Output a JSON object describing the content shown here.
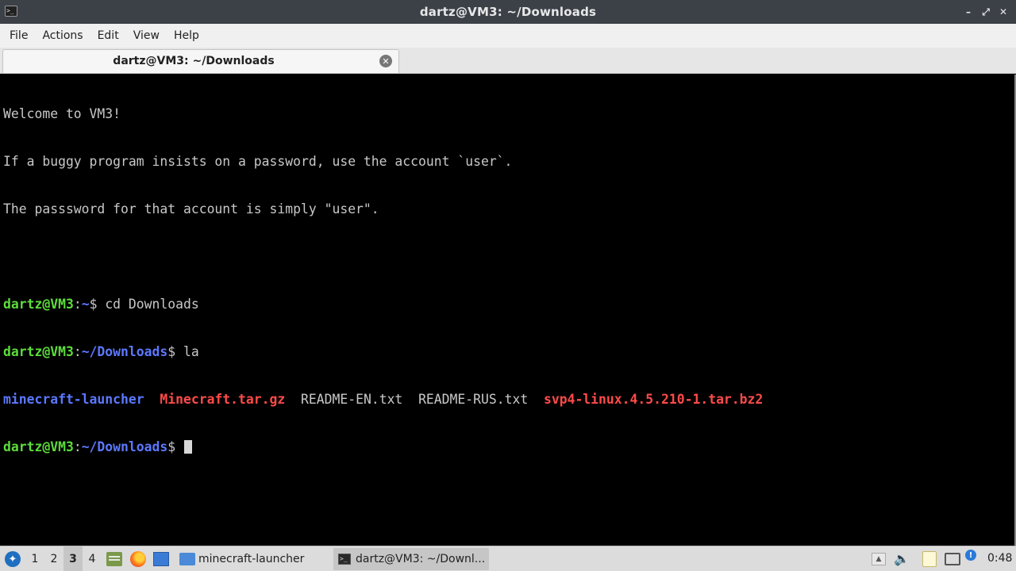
{
  "window": {
    "title": "dartz@VM3: ~/Downloads",
    "app_icon_glyph": ">_",
    "controls": {
      "minimize": "–",
      "restore": "⤢",
      "close": "✕"
    }
  },
  "menubar": {
    "items": [
      "File",
      "Actions",
      "Edit",
      "View",
      "Help"
    ]
  },
  "tabs": [
    {
      "label": "dartz@VM3: ~/Downloads",
      "close_glyph": "✕"
    }
  ],
  "terminal": {
    "motd": [
      "Welcome to VM3!",
      "If a buggy program insists on a password, use the account `user`.",
      "The passsword for that account is simply \"user\"."
    ],
    "prompt_user": "dartz@VM3",
    "cmd1": {
      "path": "~",
      "command": "cd Downloads"
    },
    "cmd2": {
      "path": "~/Downloads",
      "command": "la"
    },
    "listing": {
      "f1": "minecraft-launcher",
      "f2": "Minecraft.tar.gz",
      "f3": "README-EN.txt",
      "f4": "README-RUS.txt",
      "f5": "svp4-linux.4.5.210-1.tar.bz2"
    },
    "cmd3": {
      "path": "~/Downloads",
      "command": ""
    },
    "colors": {
      "user": "#5ddc3c",
      "path": "#5c78ff",
      "executable": "#5c78ff",
      "archive": "#ff4a4a",
      "text": "#c8c8c8"
    }
  },
  "taskbar": {
    "start_icon": "lxqt-start-icon",
    "workspaces": [
      "1",
      "2",
      "3",
      "4"
    ],
    "active_workspace": "3",
    "launchers": [
      "file-manager-icon",
      "firefox-icon",
      "show-desktop-icon"
    ],
    "tasks": [
      {
        "label": "minecraft-launcher",
        "icon": "folder-icon"
      },
      {
        "label": "dartz@VM3: ~/Downl...",
        "icon": "terminal-icon"
      }
    ],
    "tray": [
      "tray-expand-icon",
      "volume-icon",
      "clipboard-icon",
      "network-icon",
      "update-notifier-icon"
    ],
    "clock": "0:48"
  }
}
